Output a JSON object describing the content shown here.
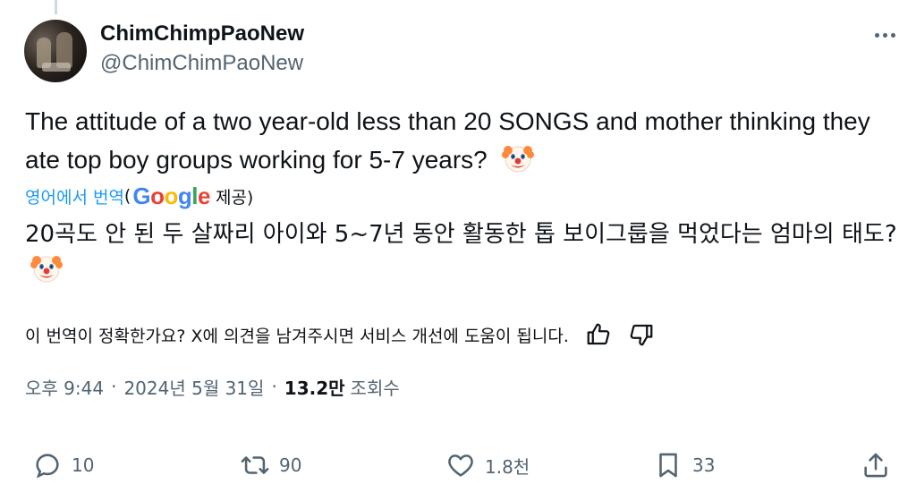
{
  "author": {
    "display_name": "ChimChimpPaoNew",
    "handle": "@ChimChimPaoNew"
  },
  "tweet": {
    "text": "The attitude of a two year-old less than 20 SONGS and mother thinking they ate top boy groups working for 5-7 years?",
    "emoji": "clown-face",
    "translate_link": "영어에서 번역",
    "translate_open_paren": "(",
    "translate_provider": "Google",
    "translate_suffix": " 제공)",
    "translated_text": "20곡도 안 된 두 살짜리 아이와 5~7년 동안 활동한 톱 보이그룹을 먹었다는 엄마의 태도?",
    "feedback_prompt": "이 번역이 정확한가요? X에 의견을 남겨주시면 서비스 개선에 도움이 됩니다."
  },
  "meta": {
    "time": "오후 9:44",
    "separator": "·",
    "date": "2024년 5월 31일",
    "views_count": "13.2만",
    "views_label": "조회수"
  },
  "actions": {
    "replies": "10",
    "reposts": "90",
    "likes": "1.8천",
    "bookmarks": "33"
  },
  "colors": {
    "text": "#0f1419",
    "secondary": "#536471",
    "link": "#1d9bf0",
    "google_blue": "#4285F4",
    "google_red": "#EA4335",
    "google_yellow": "#FBBC05",
    "google_green": "#34A853"
  }
}
